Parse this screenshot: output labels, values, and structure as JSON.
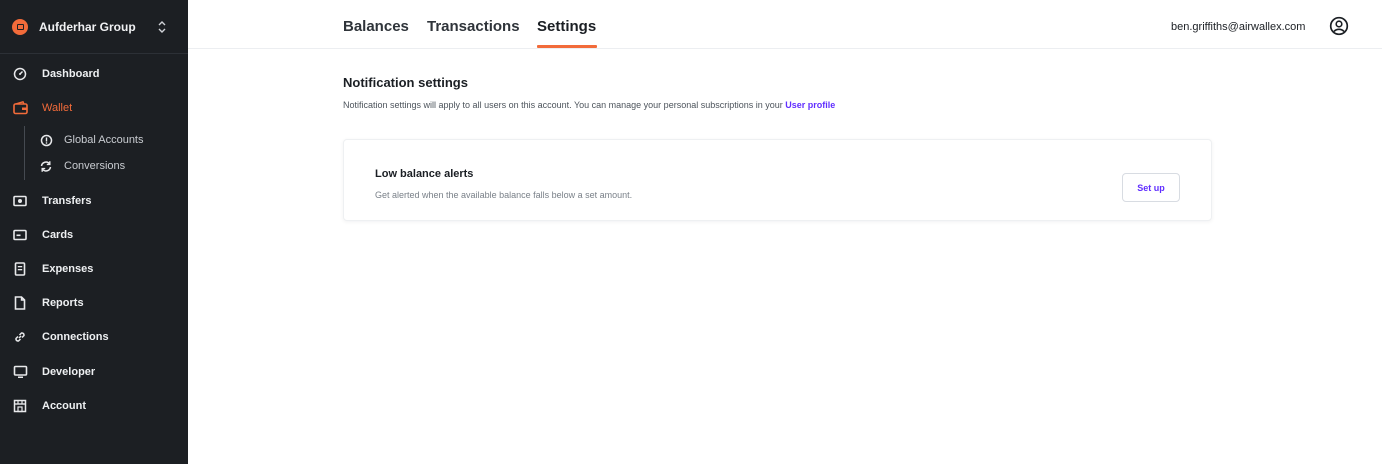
{
  "sidebar": {
    "org_name": "Aufderhar Group",
    "items": [
      {
        "label": "Dashboard",
        "icon": "dashboard-gauge-icon"
      },
      {
        "label": "Wallet",
        "icon": "wallet-icon",
        "active": true
      },
      {
        "label": "Transfers",
        "icon": "transfers-icon"
      },
      {
        "label": "Cards",
        "icon": "card-icon"
      },
      {
        "label": "Expenses",
        "icon": "receipt-icon"
      },
      {
        "label": "Reports",
        "icon": "document-icon"
      },
      {
        "label": "Connections",
        "icon": "link-icon"
      },
      {
        "label": "Developer",
        "icon": "monitor-icon"
      },
      {
        "label": "Account",
        "icon": "storefront-icon"
      }
    ],
    "wallet_sub_items": [
      {
        "label": "Global Accounts",
        "icon": "info-circle-icon"
      },
      {
        "label": "Conversions",
        "icon": "refresh-icon"
      }
    ]
  },
  "header": {
    "tabs": [
      {
        "label": "Balances"
      },
      {
        "label": "Transactions"
      },
      {
        "label": "Settings",
        "active": true
      }
    ],
    "user_email": "ben.griffiths@airwallex.com"
  },
  "main": {
    "title": "Notification settings",
    "description": "Notification settings will apply to all users on this account. You can manage your personal subscriptions in your",
    "profile_link": "User profile",
    "card": {
      "title": "Low balance alerts",
      "description": "Get alerted when the available balance falls below a set amount.",
      "button_label": "Set up"
    }
  },
  "colors": {
    "sidebar_bg": "#1c1f23",
    "accent": "#f26b3a",
    "link": "#612fff"
  }
}
